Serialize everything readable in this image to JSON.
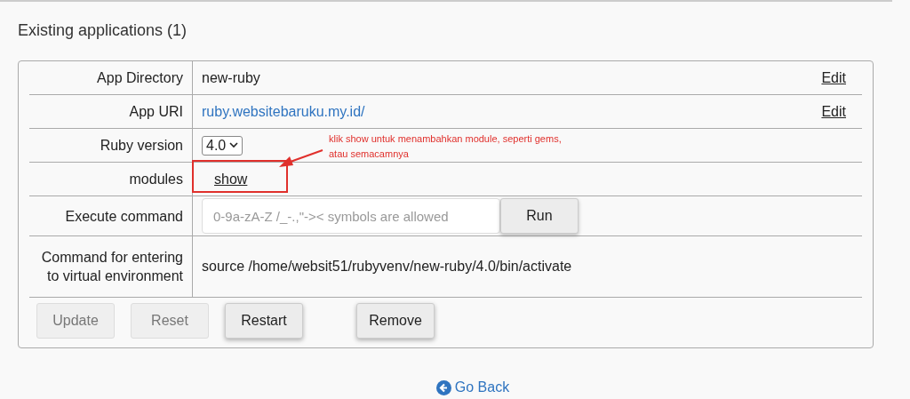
{
  "heading": "Existing applications (1)",
  "rows": [
    {
      "kind": "text",
      "label": "App Directory",
      "value": "new-ruby",
      "action": "Edit"
    },
    {
      "kind": "link",
      "label": "App URI",
      "value": "ruby.websitebaruku.my.id/",
      "action": "Edit"
    },
    {
      "kind": "select",
      "label": "Ruby version",
      "value": "4.0"
    },
    {
      "kind": "toggle",
      "label": "modules",
      "value": "show"
    },
    {
      "kind": "command",
      "label": "Execute command",
      "placeholder": "0-9a-zA-Z /_-.,\"->< symbols are allowed",
      "button": "Run"
    },
    {
      "kind": "text",
      "label": "Command for entering to virtual environment",
      "value": "source /home/websit51/rubyvenv/new-ruby/4.0/bin/activate"
    }
  ],
  "buttons": [
    {
      "label": "Update",
      "disabled": true
    },
    {
      "label": "Reset",
      "disabled": true
    },
    {
      "label": "Restart",
      "disabled": false
    },
    {
      "label": "Remove",
      "disabled": false
    }
  ],
  "annotation": {
    "text": "klik show untuk menambahkan module, seperti gems, atau semacamnya"
  },
  "back_link": "Go Back"
}
